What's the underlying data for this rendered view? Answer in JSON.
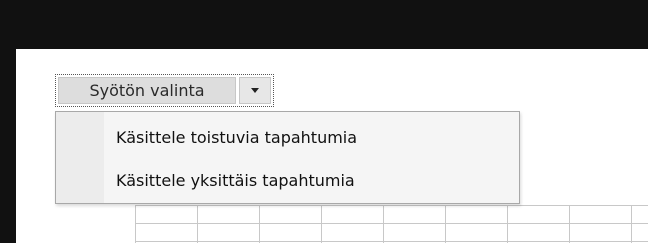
{
  "split_button": {
    "label": "Syötön valinta",
    "arrow_icon": "chevron-down-icon"
  },
  "menu": {
    "items": [
      {
        "label": "Käsittele toistuvia tapahtumia"
      },
      {
        "label": "Käsittele yksittäis tapahtumia"
      }
    ]
  },
  "colors": {
    "frame": "#111111",
    "button_face": "#dddddd",
    "menu_background": "#f5f5f5",
    "grid_line": "#c8c8c8"
  }
}
